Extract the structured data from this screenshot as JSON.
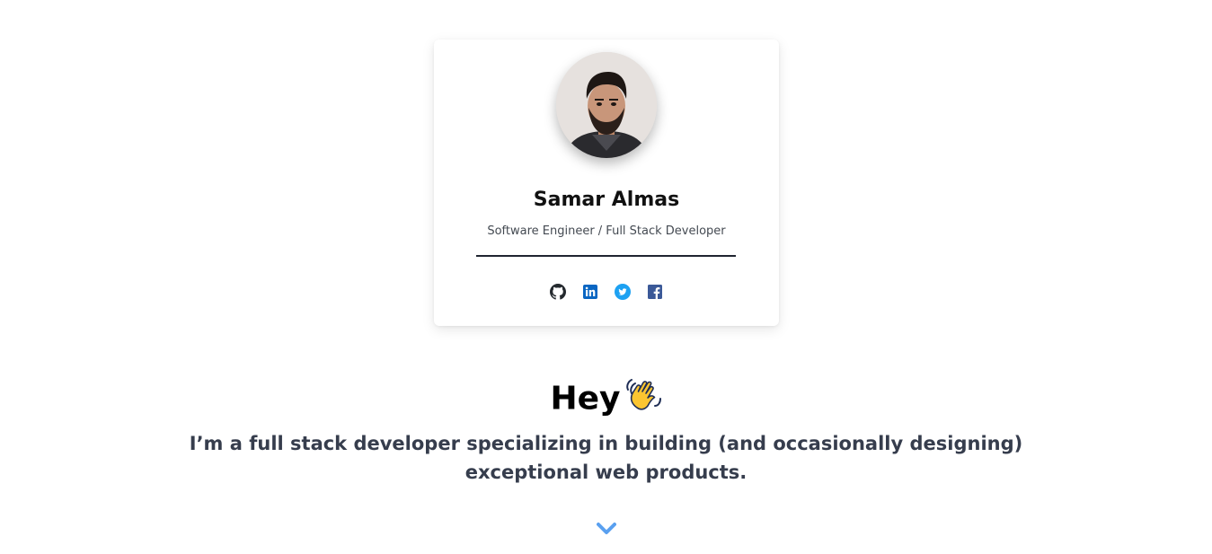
{
  "profile": {
    "name": "Samar Almas",
    "role": "Software Engineer / Full Stack Developer",
    "avatar_alt": "profile photo"
  },
  "socials": [
    {
      "name": "github",
      "icon": "github-icon",
      "color": "#24292e"
    },
    {
      "name": "linkedin",
      "icon": "linkedin-icon",
      "color": "#0a66c2"
    },
    {
      "name": "twitter",
      "icon": "twitter-icon",
      "color": "#1da1f2"
    },
    {
      "name": "facebook",
      "icon": "facebook-icon",
      "color": "#3b5998"
    }
  ],
  "hero": {
    "title": "Hey",
    "title_emoji": "waving-hand-icon",
    "subtitle": "I’m a full stack developer specializing in building (and occasionally designing) exceptional web products."
  },
  "scroll": {
    "icon": "chevron-down-icon",
    "color": "#5aa0f0"
  }
}
